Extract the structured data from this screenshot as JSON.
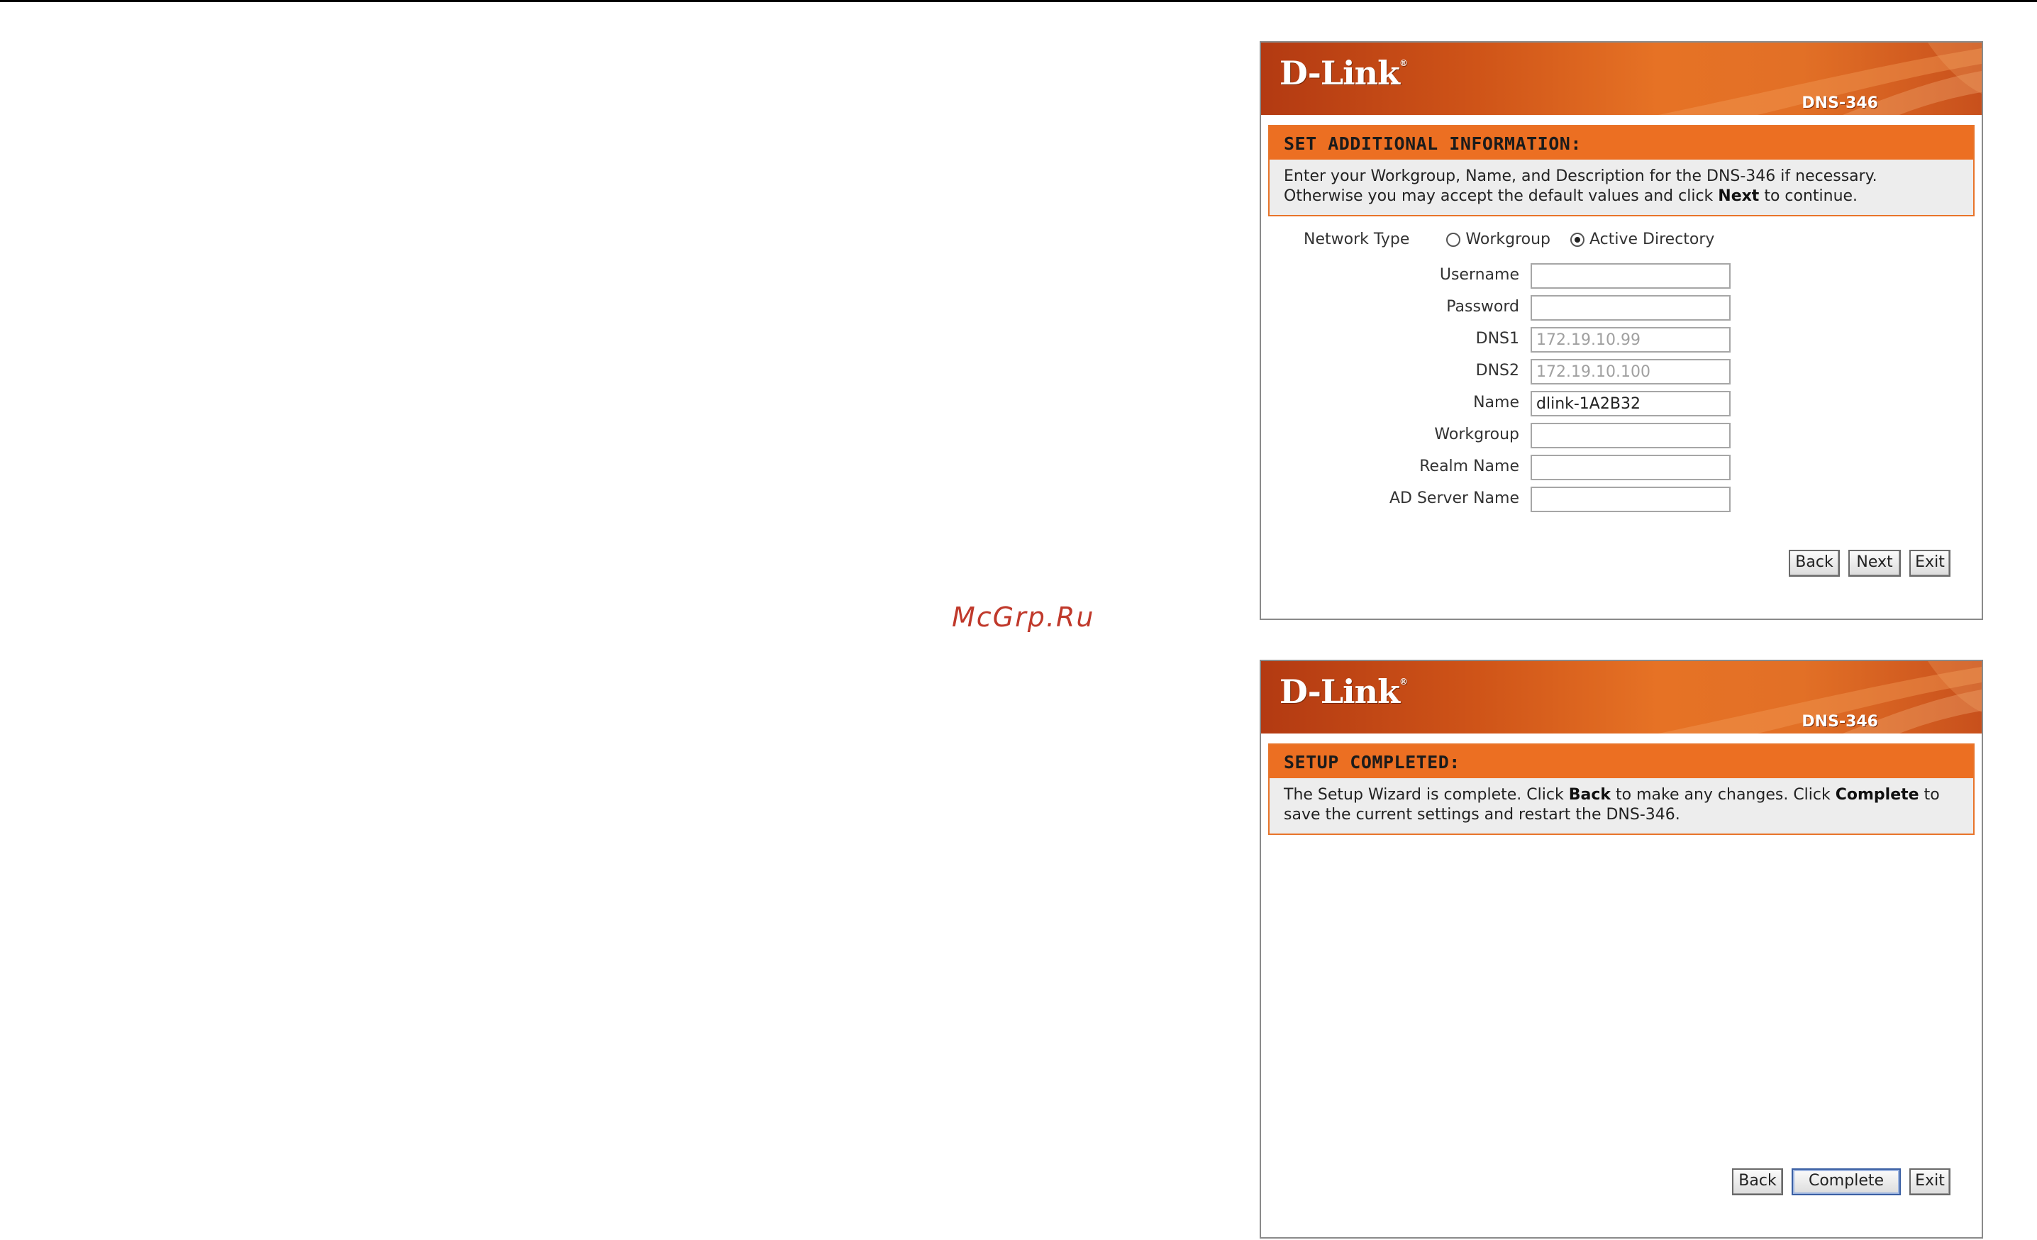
{
  "watermark": "McGrp.Ru",
  "panel_additional": {
    "brand": "D-Link",
    "model": "DNS-346",
    "title": "SET ADDITIONAL INFORMATION:",
    "desc_1": "Enter your Workgroup, Name, and Description for the DNS-346 if necessary.",
    "desc_2_pre": "Otherwise you may accept the default values and click ",
    "desc_2_bold": "Next",
    "desc_2_post": " to continue.",
    "network_type_label": "Network Type",
    "radio_workgroup": "Workgroup",
    "radio_active_directory": "Active Directory",
    "selected_network_type": "Active Directory",
    "fields": {
      "username": {
        "label": "Username",
        "value": ""
      },
      "password": {
        "label": "Password",
        "value": ""
      },
      "dns1": {
        "label": "DNS1",
        "placeholder": "172.19.10.99"
      },
      "dns2": {
        "label": "DNS2",
        "placeholder": "172.19.10.100"
      },
      "name": {
        "label": "Name",
        "value": "dlink-1A2B32"
      },
      "workgroup": {
        "label": "Workgroup",
        "value": ""
      },
      "realm_name": {
        "label": "Realm Name",
        "value": ""
      },
      "ad_server_name": {
        "label": "AD Server Name",
        "value": ""
      }
    },
    "buttons": {
      "back": "Back",
      "next": "Next",
      "exit": "Exit"
    }
  },
  "panel_complete": {
    "brand": "D-Link",
    "model": "DNS-346",
    "title": "SETUP COMPLETED:",
    "desc_1_pre": "The Setup Wizard is complete. Click ",
    "desc_1_bold1": "Back",
    "desc_1_mid": " to make any changes. Click ",
    "desc_1_bold2": "Complete",
    "desc_1_post": " to",
    "desc_2": "save the current settings and restart the DNS-346.",
    "buttons": {
      "back": "Back",
      "complete": "Complete",
      "exit": "Exit"
    }
  }
}
